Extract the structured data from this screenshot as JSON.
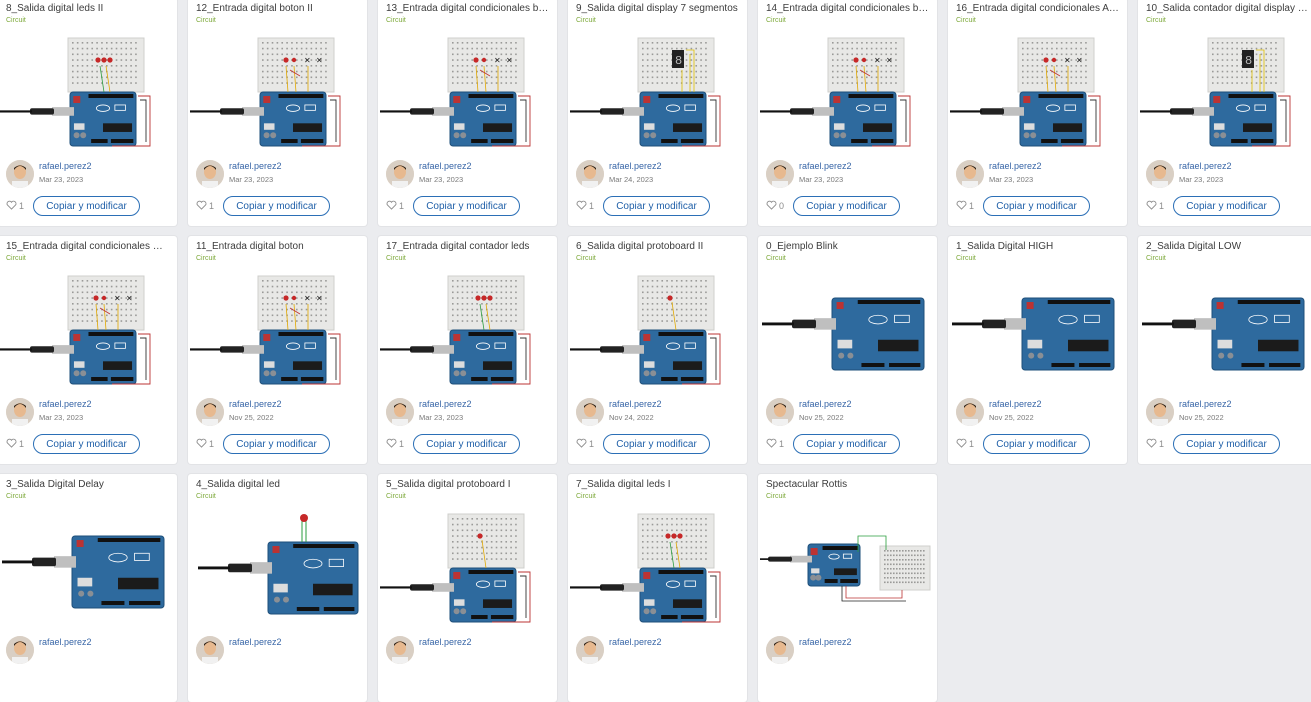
{
  "cards": [
    {
      "title": "8_Salida digital leds II",
      "type": "Circuit",
      "user": "rafael.perez2",
      "date": "Mar 23, 2023",
      "likes": "1",
      "button": "Copiar y modificar",
      "thumb": "breadboard-leds"
    },
    {
      "title": "12_Entrada digital boton II",
      "type": "Circuit",
      "user": "rafael.perez2",
      "date": "Mar 23, 2023",
      "likes": "1",
      "button": "Copiar y modificar",
      "thumb": "breadboard-buttons"
    },
    {
      "title": "13_Entrada digital condicionales bo…",
      "type": "Circuit",
      "user": "rafael.perez2",
      "date": "Mar 23, 2023",
      "likes": "1",
      "button": "Copiar y modificar",
      "thumb": "breadboard-buttons"
    },
    {
      "title": "9_Salida digital display 7 segmentos",
      "type": "Circuit",
      "user": "rafael.perez2",
      "date": "Mar 24, 2023",
      "likes": "1",
      "button": "Copiar y modificar",
      "thumb": "breadboard-display"
    },
    {
      "title": "14_Entrada digital condicionales bo…",
      "type": "Circuit",
      "user": "rafael.perez2",
      "date": "Mar 23, 2023",
      "likes": "0",
      "button": "Copiar y modificar",
      "thumb": "breadboard-buttons"
    },
    {
      "title": "16_Entrada digital condicionales A…",
      "type": "Circuit",
      "user": "rafael.perez2",
      "date": "Mar 23, 2023",
      "likes": "1",
      "button": "Copiar y modificar",
      "thumb": "breadboard-buttons"
    },
    {
      "title": "10_Salida contador digital display 7…",
      "type": "Circuit",
      "user": "rafael.perez2",
      "date": "Mar 23, 2023",
      "likes": "1",
      "button": "Copiar y modificar",
      "thumb": "breadboard-display"
    },
    {
      "title": "15_Entrada digital condicionales O…",
      "type": "Circuit",
      "user": "rafael.perez2",
      "date": "Mar 23, 2023",
      "likes": "1",
      "button": "Copiar y modificar",
      "thumb": "breadboard-buttons"
    },
    {
      "title": "11_Entrada digital boton",
      "type": "Circuit",
      "user": "rafael.perez2",
      "date": "Nov 25, 2022",
      "likes": "1",
      "button": "Copiar y modificar",
      "thumb": "breadboard-button"
    },
    {
      "title": "17_Entrada digital contador leds",
      "type": "Circuit",
      "user": "rafael.perez2",
      "date": "Mar 23, 2023",
      "likes": "1",
      "button": "Copiar y modificar",
      "thumb": "breadboard-leds"
    },
    {
      "title": "6_Salida digital protoboard II",
      "type": "Circuit",
      "user": "rafael.perez2",
      "date": "Nov 24, 2022",
      "likes": "1",
      "button": "Copiar y modificar",
      "thumb": "breadboard-led"
    },
    {
      "title": "0_Ejemplo Blink",
      "type": "Circuit",
      "user": "rafael.perez2",
      "date": "Nov 25, 2022",
      "likes": "1",
      "button": "Copiar y modificar",
      "thumb": "arduino"
    },
    {
      "title": "1_Salida Digital HIGH",
      "type": "Circuit",
      "user": "rafael.perez2",
      "date": "Nov 25, 2022",
      "likes": "1",
      "button": "Copiar y modificar",
      "thumb": "arduino"
    },
    {
      "title": "2_Salida Digital LOW",
      "type": "Circuit",
      "user": "rafael.perez2",
      "date": "Nov 25, 2022",
      "likes": "1",
      "button": "Copiar y modificar",
      "thumb": "arduino"
    },
    {
      "title": "3_Salida Digital Delay",
      "type": "Circuit",
      "user": "rafael.perez2",
      "date": "",
      "likes": "",
      "button": "",
      "thumb": "arduino"
    },
    {
      "title": "4_Salida digital led",
      "type": "Circuit",
      "user": "rafael.perez2",
      "date": "",
      "likes": "",
      "button": "",
      "thumb": "arduino-led"
    },
    {
      "title": "5_Salida digital protoboard I",
      "type": "Circuit",
      "user": "rafael.perez2",
      "date": "",
      "likes": "",
      "button": "",
      "thumb": "breadboard-led"
    },
    {
      "title": "7_Salida digital leds I",
      "type": "Circuit",
      "user": "rafael.perez2",
      "date": "",
      "likes": "",
      "button": "",
      "thumb": "breadboard-leds"
    },
    {
      "title": "Spectacular Rottis",
      "type": "Circuit",
      "user": "rafael.perez2",
      "date": "",
      "likes": "",
      "button": "",
      "thumb": "spectacular"
    }
  ],
  "icons": {
    "like": "heart-icon",
    "avatar": "user-avatar"
  },
  "colors": {
    "accent": "#2b6fb6",
    "circuit": "#7da93a",
    "board": "#2e6a9e",
    "background": "#ebecef"
  }
}
